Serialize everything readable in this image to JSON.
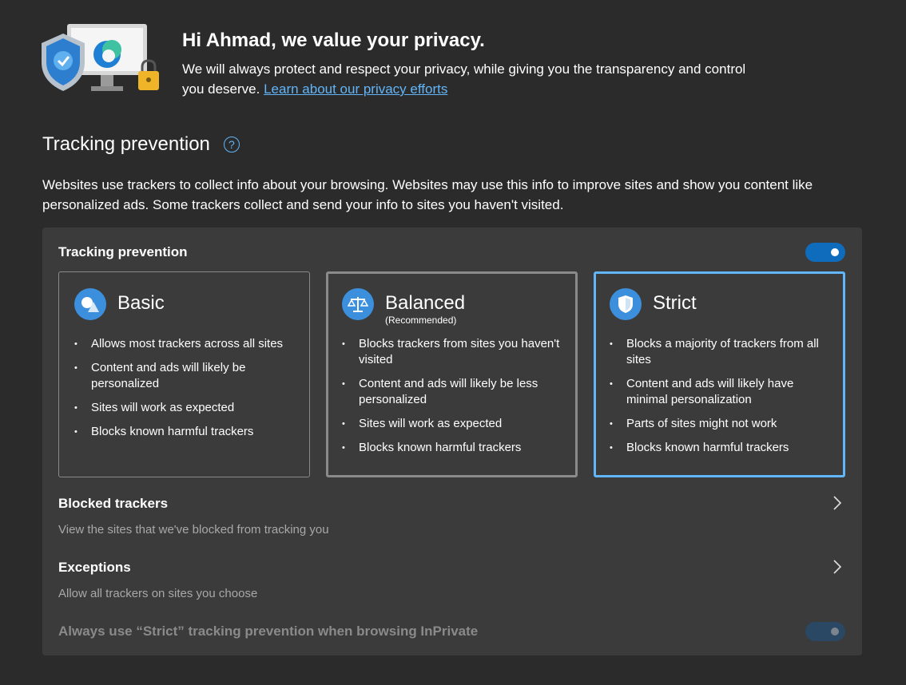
{
  "header": {
    "title": "Hi Ahmad, we value your privacy.",
    "desc": "We will always protect and respect your privacy, while giving you the transparency and control you deserve.",
    "link": "Learn about our privacy efforts"
  },
  "section": {
    "title": "Tracking prevention",
    "help_icon": "question-circle-icon",
    "desc": "Websites use trackers to collect info about your browsing. Websites may use this info to improve sites and show you content like personalized ads. Some trackers collect and send your info to sites you haven't visited."
  },
  "card": {
    "title": "Tracking prevention",
    "toggle_on": true,
    "options": [
      {
        "label": "Basic",
        "sub": "",
        "icon": "basic-shapes-icon",
        "bullets": [
          "Allows most trackers across all sites",
          "Content and ads will likely be personalized",
          "Sites will work as expected",
          "Blocks known harmful trackers"
        ]
      },
      {
        "label": "Balanced",
        "sub": "(Recommended)",
        "icon": "scales-icon",
        "bullets": [
          "Blocks trackers from sites you haven't visited",
          "Content and ads will likely be less personalized",
          "Sites will work as expected",
          "Blocks known harmful trackers"
        ]
      },
      {
        "label": "Strict",
        "sub": "",
        "icon": "shield-icon",
        "selected": true,
        "bullets": [
          "Blocks a majority of trackers from all sites",
          "Content and ads will likely have minimal personalization",
          "Parts of sites might not work",
          "Blocks known harmful trackers"
        ]
      }
    ],
    "blocked": {
      "title": "Blocked trackers",
      "desc": "View the sites that we've blocked from tracking you"
    },
    "exceptions": {
      "title": "Exceptions",
      "desc": "Allow all trackers on sites you choose"
    },
    "inprivate": {
      "label": "Always use “Strict” tracking prevention when browsing InPrivate",
      "toggle_on": true,
      "disabled": true
    }
  },
  "colors": {
    "accent": "#62b5f8",
    "toggle": "#0f6cbd",
    "background": "#2b2b2b",
    "card": "#3b3b3b"
  }
}
